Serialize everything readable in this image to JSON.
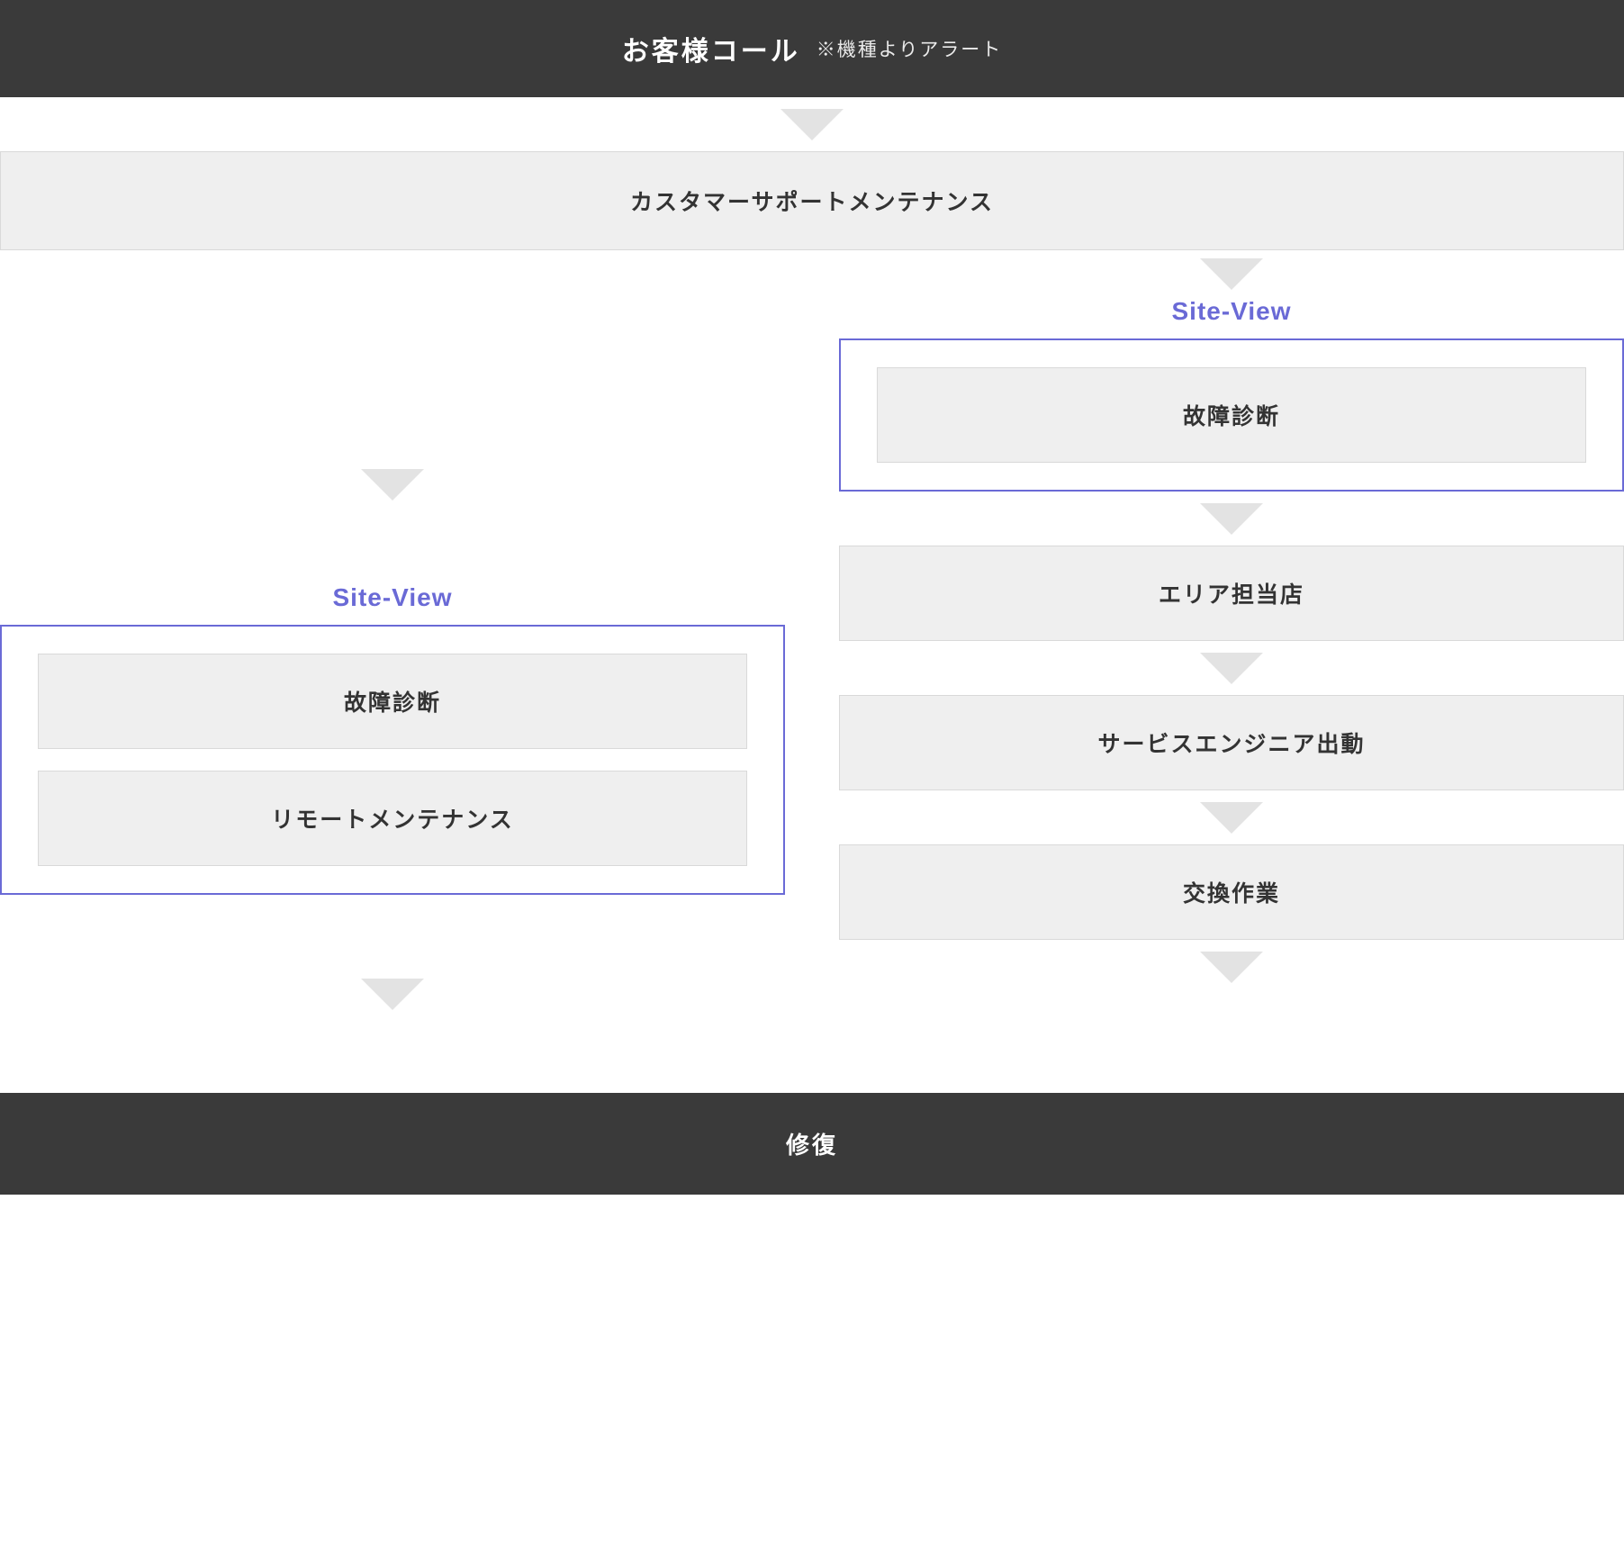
{
  "colors": {
    "dark": "#3a3a3a",
    "accent": "#6a6ad6",
    "grey_box": "#efefef",
    "grey_border": "#d9d9d9",
    "text_dark": "#333333",
    "arrow_fill": "#e3e3e3"
  },
  "header": {
    "main": "お客様コール",
    "sub": "※機種よりアラート"
  },
  "main_box": "カスタマーサポートメンテナンス",
  "site_view_label": "Site-View",
  "left": {
    "items": [
      "故障診断",
      "リモートメンテナンス"
    ]
  },
  "right": {
    "sv_items": [
      "故障診断"
    ],
    "steps": [
      "エリア担当店",
      "サービスエンジニア出動",
      "交換作業"
    ]
  },
  "footer": "修復"
}
